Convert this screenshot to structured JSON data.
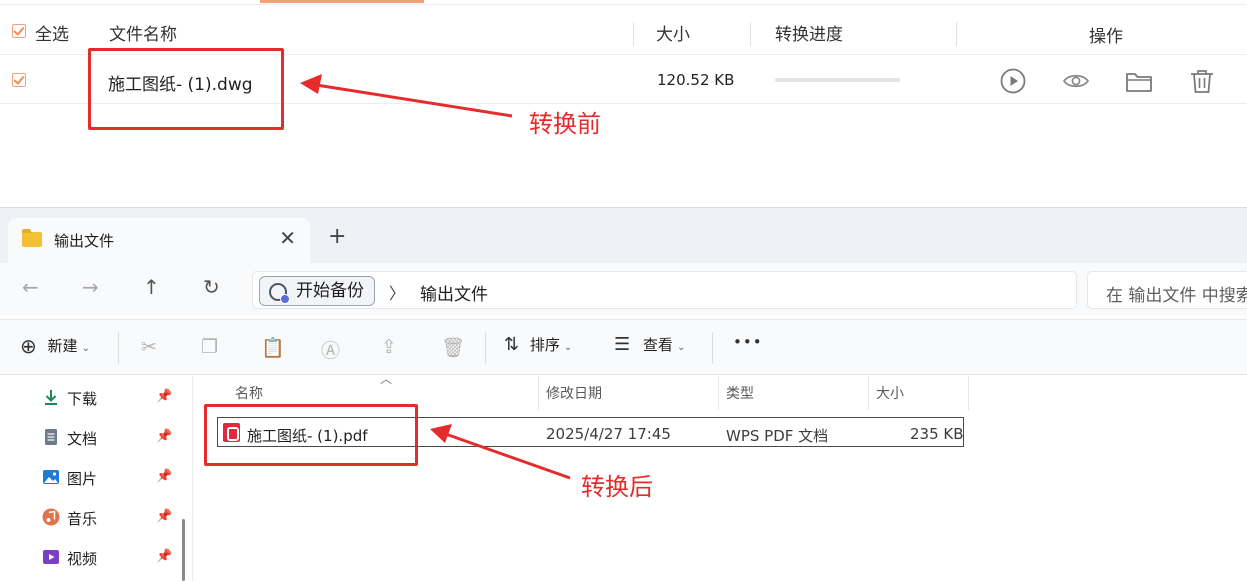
{
  "converter": {
    "select_all_label": "全选",
    "columns": {
      "filename": "文件名称",
      "size": "大小",
      "progress": "转换进度",
      "actions": "操作"
    },
    "file": {
      "name": "施工图纸- (1).dwg",
      "size": "120.52 KB",
      "progress": 0
    },
    "action_icons": [
      "play-icon",
      "eye-icon",
      "folder-icon",
      "trash-icon"
    ]
  },
  "annotations": {
    "before": "转换前",
    "after": "转换后",
    "color": "#e52b2b"
  },
  "explorer": {
    "tab_title": "输出文件",
    "tab_close": "✕",
    "new_tab": "+",
    "breadcrumb": {
      "root": "开始备份",
      "current": "输出文件"
    },
    "search_placeholder": "在 输出文件 中搜索",
    "toolbar": {
      "new_label": "新建",
      "sort_label": "排序",
      "view_label": "查看",
      "more": "•••"
    },
    "sidebar": [
      {
        "label": "下载",
        "icon": "download-icon"
      },
      {
        "label": "文档",
        "icon": "document-icon"
      },
      {
        "label": "图片",
        "icon": "pictures-icon"
      },
      {
        "label": "音乐",
        "icon": "music-icon"
      },
      {
        "label": "视频",
        "icon": "video-icon"
      }
    ],
    "columns": {
      "name": "名称",
      "modified": "修改日期",
      "type": "类型",
      "size": "大小"
    },
    "files": [
      {
        "name": "施工图纸- (1).pdf",
        "modified": "2025/4/27 17:45",
        "type": "WPS PDF 文档",
        "size": "235 KB"
      }
    ]
  }
}
